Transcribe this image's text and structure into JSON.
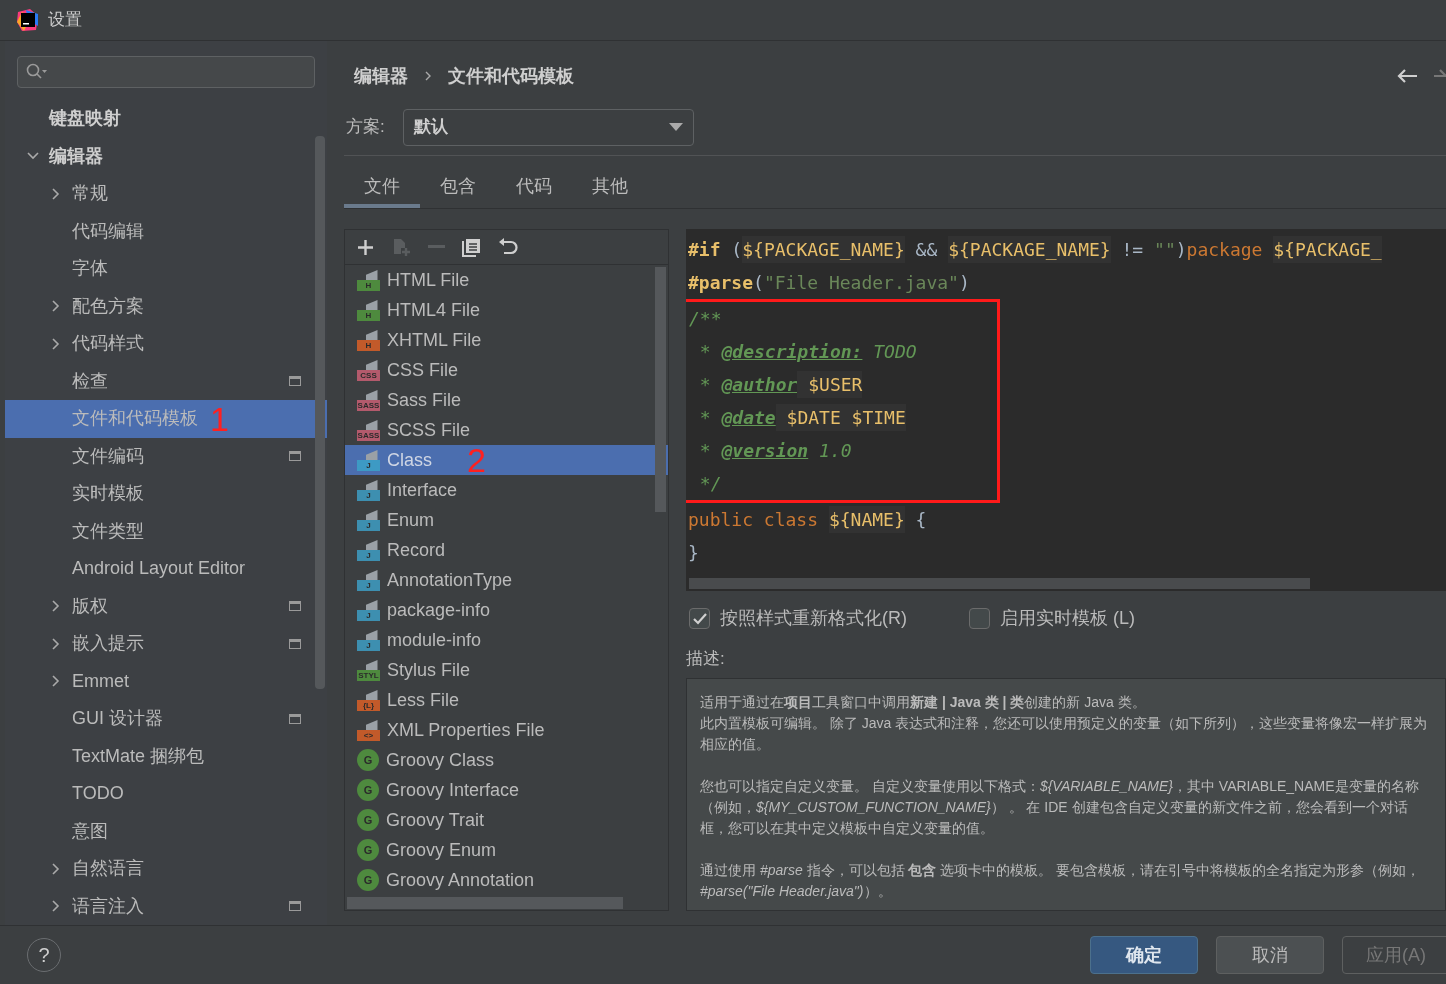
{
  "window": {
    "title": "设置"
  },
  "sidebar": {
    "items": [
      {
        "label": "键盘映射",
        "bold": true,
        "selected": false,
        "project_icon": false
      },
      {
        "label": "编辑器",
        "bold": true,
        "expanded": true,
        "selected": false,
        "project_icon": false,
        "children": [
          {
            "label": "常规",
            "expanded": false,
            "selected": false,
            "project_icon": false
          },
          {
            "label": "代码编辑",
            "selected": false,
            "project_icon": false
          },
          {
            "label": "字体",
            "selected": false,
            "project_icon": false
          },
          {
            "label": "配色方案",
            "expanded": false,
            "selected": false,
            "project_icon": false
          },
          {
            "label": "代码样式",
            "expanded": false,
            "selected": false,
            "project_icon": false
          },
          {
            "label": "检查",
            "selected": false,
            "project_icon": true
          },
          {
            "label": "文件和代码模板",
            "selected": true,
            "project_icon": false,
            "annotation": "1"
          },
          {
            "label": "文件编码",
            "selected": false,
            "project_icon": true
          },
          {
            "label": "实时模板",
            "selected": false,
            "project_icon": false
          },
          {
            "label": "文件类型",
            "selected": false,
            "project_icon": false
          },
          {
            "label": "Android Layout Editor",
            "selected": false,
            "project_icon": false
          },
          {
            "label": "版权",
            "expanded": false,
            "selected": false,
            "project_icon": true
          },
          {
            "label": "嵌入提示",
            "expanded": false,
            "selected": false,
            "project_icon": true
          },
          {
            "label": "Emmet",
            "expanded": false,
            "selected": false,
            "project_icon": false
          },
          {
            "label": "GUI 设计器",
            "selected": false,
            "project_icon": true
          },
          {
            "label": "TextMate 捆绑包",
            "selected": false,
            "project_icon": false
          },
          {
            "label": "TODO",
            "selected": false,
            "project_icon": false
          },
          {
            "label": "意图",
            "selected": false,
            "project_icon": false
          },
          {
            "label": "自然语言",
            "expanded": false,
            "selected": false,
            "project_icon": false
          },
          {
            "label": "语言注入",
            "expanded": false,
            "selected": false,
            "project_icon": true
          }
        ]
      }
    ]
  },
  "breadcrumb": [
    "编辑器",
    "文件和代码模板"
  ],
  "scheme": {
    "label": "方案:",
    "value": "默认"
  },
  "tabs": [
    {
      "label": "文件",
      "selected": true
    },
    {
      "label": "包含",
      "selected": false
    },
    {
      "label": "代码",
      "selected": false
    },
    {
      "label": "其他",
      "selected": false
    }
  ],
  "templates": [
    {
      "label": "HTML File",
      "kind": "file",
      "badge": "H",
      "color": "#4e8a3e",
      "selected": false
    },
    {
      "label": "HTML4 File",
      "kind": "file",
      "badge": "H",
      "color": "#4e8a3e",
      "selected": false
    },
    {
      "label": "XHTML File",
      "kind": "file",
      "badge": "H",
      "color": "#c25a2a",
      "selected": false
    },
    {
      "label": "CSS File",
      "kind": "file",
      "badge": "CSS",
      "color": "#b35a6c",
      "selected": false
    },
    {
      "label": "Sass File",
      "kind": "file",
      "badge": "SASS",
      "color": "#b35a6c",
      "selected": false
    },
    {
      "label": "SCSS File",
      "kind": "file",
      "badge": "SASS",
      "color": "#b35a6c",
      "selected": false
    },
    {
      "label": "Class",
      "kind": "file",
      "badge": "J",
      "color": "#3d9ac4",
      "selected": true,
      "annotation": "2"
    },
    {
      "label": "Interface",
      "kind": "file",
      "badge": "J",
      "color": "#3d8fb0",
      "selected": false
    },
    {
      "label": "Enum",
      "kind": "file",
      "badge": "J",
      "color": "#3d8fb0",
      "selected": false
    },
    {
      "label": "Record",
      "kind": "file",
      "badge": "J",
      "color": "#3d8fb0",
      "selected": false
    },
    {
      "label": "AnnotationType",
      "kind": "file",
      "badge": "J",
      "color": "#3d8fb0",
      "selected": false
    },
    {
      "label": "package-info",
      "kind": "file",
      "badge": "J",
      "color": "#3d8fb0",
      "selected": false
    },
    {
      "label": "module-info",
      "kind": "file",
      "badge": "J",
      "color": "#3d8fb0",
      "selected": false
    },
    {
      "label": "Stylus File",
      "kind": "file",
      "badge": "STYL",
      "color": "#4e8a3e",
      "selected": false
    },
    {
      "label": "Less File",
      "kind": "file",
      "badge": "{L}",
      "color": "#c25a2a",
      "selected": false
    },
    {
      "label": "XML Properties File",
      "kind": "file",
      "badge": "<>",
      "color": "#c25a2a",
      "selected": false
    },
    {
      "label": "Groovy Class",
      "kind": "groovy",
      "badge": "G",
      "color": "#4e8a3e",
      "selected": false
    },
    {
      "label": "Groovy Interface",
      "kind": "groovy",
      "badge": "G",
      "color": "#4e8a3e",
      "selected": false
    },
    {
      "label": "Groovy Trait",
      "kind": "groovy",
      "badge": "G",
      "color": "#4e8a3e",
      "selected": false
    },
    {
      "label": "Groovy Enum",
      "kind": "groovy",
      "badge": "G",
      "color": "#4e8a3e",
      "selected": false
    },
    {
      "label": "Groovy Annotation",
      "kind": "groovy",
      "badge": "G",
      "color": "#4e8a3e",
      "selected": false
    }
  ],
  "code": {
    "lines": [
      {
        "boxed": false,
        "tokens": [
          {
            "kind": "directive",
            "t": "#if"
          },
          {
            "kind": "plain",
            "t": " ("
          },
          {
            "kind": "var",
            "t": "${PACKAGE_NAME}"
          },
          {
            "kind": "plain",
            "t": " && "
          },
          {
            "kind": "var",
            "t": "${PACKAGE_NAME}"
          },
          {
            "kind": "plain",
            "t": " != "
          },
          {
            "kind": "string",
            "t": "\"\""
          },
          {
            "kind": "plain",
            "t": ")"
          },
          {
            "kind": "keyword",
            "t": "package "
          },
          {
            "kind": "var",
            "t": "${PACKAGE_"
          }
        ]
      },
      {
        "boxed": false,
        "tokens": [
          {
            "kind": "directive",
            "t": "#parse"
          },
          {
            "kind": "plain",
            "t": "("
          },
          {
            "kind": "string",
            "t": "\"File Header.java\""
          },
          {
            "kind": "plain",
            "t": ")"
          }
        ]
      },
      {
        "boxed": true,
        "tokens": [
          {
            "kind": "comment",
            "t": "/**"
          }
        ]
      },
      {
        "boxed": true,
        "tokens": [
          {
            "kind": "comment",
            "t": " * "
          },
          {
            "kind": "tag",
            "t": "@description:"
          },
          {
            "kind": "comment",
            "t": " TODO"
          }
        ]
      },
      {
        "boxed": true,
        "tokens": [
          {
            "kind": "comment",
            "t": " * "
          },
          {
            "kind": "tag",
            "t": "@author"
          },
          {
            "kind": "var",
            "t": " $USER"
          }
        ]
      },
      {
        "boxed": true,
        "tokens": [
          {
            "kind": "comment",
            "t": " * "
          },
          {
            "kind": "tag",
            "t": "@date"
          },
          {
            "kind": "var",
            "t": " $DATE"
          },
          {
            "kind": "var",
            "t": " $TIME"
          }
        ]
      },
      {
        "boxed": true,
        "tokens": [
          {
            "kind": "comment",
            "t": " * "
          },
          {
            "kind": "tag",
            "t": "@version"
          },
          {
            "kind": "comment",
            "t": " 1.0"
          }
        ]
      },
      {
        "boxed": true,
        "tokens": [
          {
            "kind": "comment",
            "t": " */"
          }
        ]
      },
      {
        "boxed": false,
        "tokens": [
          {
            "kind": "keyword",
            "t": "public class "
          },
          {
            "kind": "var",
            "t": "${NAME}"
          },
          {
            "kind": "plain",
            "t": " {"
          }
        ]
      },
      {
        "boxed": false,
        "tokens": [
          {
            "kind": "plain",
            "t": "}"
          }
        ]
      }
    ]
  },
  "options": [
    {
      "label": "按照样式重新格式化(R)",
      "checked": true
    },
    {
      "label": "启用实时模板 (L)",
      "checked": false
    }
  ],
  "description": {
    "label": "描述:",
    "paragraphs": [
      {
        "lines": [
          "适用于通过在**项目**工具窗口中调用**新建 | Java 类 | 类**创建的新 Java 类。",
          "此内置模板可编辑。 除了 Java 表达式和注释，您还可以使用预定义的变量（如下所列），这些变量将像宏一样扩展为相应的值。"
        ]
      },
      {
        "lines": [
          "您也可以指定自定义变量。 自定义变量使用以下格式：*${VARIABLE_NAME}*，其中 VARIABLE_NAME是变量的名称（例如，*${MY_CUSTOM_FUNCTION_NAME}*） 。 在 IDE 创建包含自定义变量的新文件之前，您会看到一个对话框，您可以在其中定义模板中自定义变量的值。"
        ]
      },
      {
        "lines": [
          "通过使用 *#parse* 指令，可以包括 **包含** 选项卡中的模板。 要包含模板，请在引号中将模板的全名指定为形参（例如，*#parse(\"File Header.java\")*）。"
        ]
      }
    ]
  },
  "help": "?",
  "buttons": [
    {
      "label": "确定",
      "kind": "primary",
      "disabled": false
    },
    {
      "label": "取消",
      "kind": "normal",
      "disabled": false
    },
    {
      "label": "应用(A)",
      "kind": "normal",
      "disabled": true
    }
  ]
}
